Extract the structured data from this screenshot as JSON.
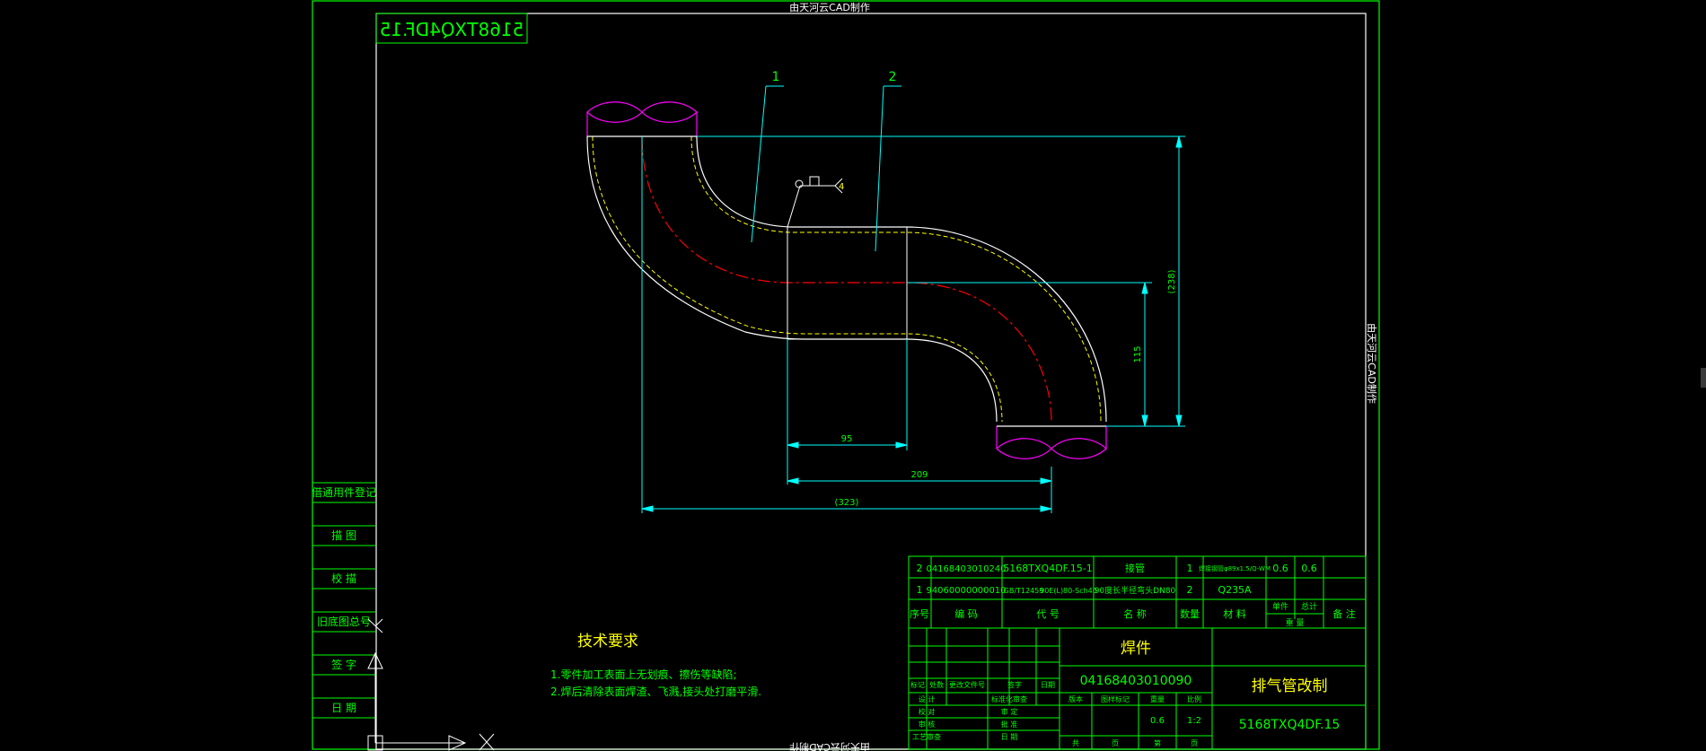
{
  "colors": {
    "frame": "#00ff00",
    "dimension": "#00ffff",
    "pipe_end": "#ff00ff",
    "centerline": "#ff0000",
    "hidden": "#ffff00",
    "outline": "#ffffff"
  },
  "top_banner": "由天河云CAD制作",
  "bottom_banner": "由天河云CAD制作",
  "right_banner": "由天河云CAD制作",
  "drawing_number_box": "5168TXQ4DF.15",
  "balloons": [
    "1",
    "2"
  ],
  "weld_symbol": {
    "side_number": "4"
  },
  "dimensions": {
    "d95": "95",
    "d209": "209",
    "d323": "(323)",
    "d115": "115",
    "d238": "(238)"
  },
  "left_column": [
    "借通用件登记",
    "描 图",
    "校 描",
    "旧底图总号",
    "签 字",
    "日 期"
  ],
  "tech_req": {
    "title": "技术要求",
    "items": [
      "1.零件加工表面上无划痕、擦伤等缺陷;",
      "2.焊后清除表面焊渣、飞溅,接头处打磨平滑."
    ]
  },
  "bom": {
    "rows": [
      {
        "seq": "2",
        "code": "04168403010240",
        "ref": "5168TXQ4DF.15-1",
        "name": "接管",
        "qty": "1",
        "material": "焊接钢管φ89x1.5/Q-WM",
        "single": "0.6",
        "total": "0.6",
        "note": ""
      },
      {
        "seq": "1",
        "code": "94060000000010",
        "ref": "GB/T12459",
        "std": "90E(L)80-Sch40",
        "name": "90度长半径弯头DN80",
        "qty": "2",
        "material": "Q235A",
        "single": "",
        "total": "",
        "note": ""
      }
    ],
    "header": {
      "seq": "序号",
      "code": "编 码",
      "ref": "代 号",
      "name": "名 称",
      "qty": "数量",
      "material": "材 料",
      "single": "单件",
      "total": "总计",
      "weight": "重 量",
      "note": "备 注"
    }
  },
  "title_block": {
    "part_type": "焊件",
    "part_code": "04168403010090",
    "drawing_title": "排气管改制",
    "drawing_code": "5168TXQ4DF.15",
    "revision_labels": [
      "标记",
      "处数",
      "更改文件号",
      "签字",
      "日期"
    ],
    "sign_labels": [
      "设 计",
      "校 对",
      "审 核",
      "工艺审查"
    ],
    "sign_labels2": [
      "标准化审查",
      "审 定",
      "批 准",
      "日 期"
    ],
    "stage_labels": [
      "版本",
      "图样标记",
      "重量",
      "比例"
    ],
    "weight": "0.6",
    "scale": "1:2",
    "sheet_labels": [
      "共",
      "页",
      "第",
      "页"
    ]
  }
}
